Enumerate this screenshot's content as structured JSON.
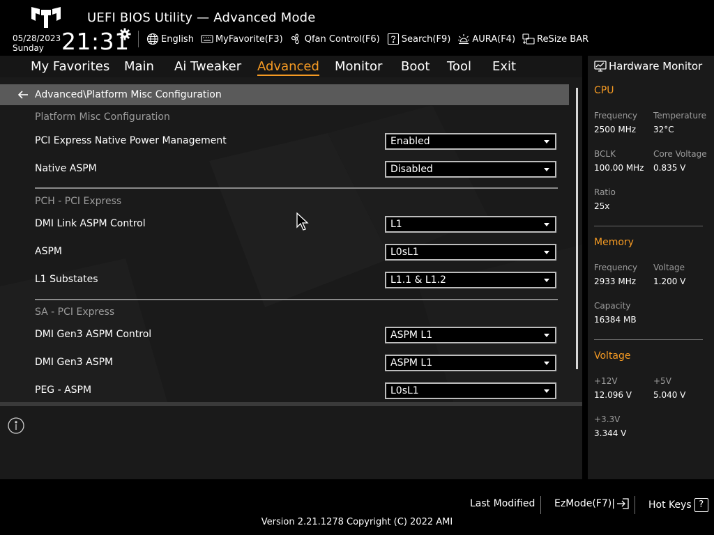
{
  "header": {
    "title": "UEFI BIOS Utility — Advanced Mode",
    "date": "05/28/2023",
    "day": "Sunday",
    "time": "21:31"
  },
  "toolbar": [
    {
      "icon": "globe-icon",
      "label": "English"
    },
    {
      "icon": "keyboard-icon",
      "label": "MyFavorite(F3)"
    },
    {
      "icon": "fan-icon",
      "label": "Qfan Control(F6)"
    },
    {
      "icon": "question-icon",
      "label": "Search(F9)"
    },
    {
      "icon": "aura-icon",
      "label": "AURA(F4)"
    },
    {
      "icon": "resize-bar-icon",
      "label": "ReSize BAR"
    }
  ],
  "menu": {
    "tabs": [
      "My Favorites",
      "Main",
      "Ai Tweaker",
      "Advanced",
      "Monitor",
      "Boot",
      "Tool",
      "Exit"
    ],
    "active": "Advanced"
  },
  "breadcrumb": "Advanced\\Platform Misc Configuration",
  "sections": {
    "platform": "Platform Misc Configuration",
    "pch": "PCH - PCI Express",
    "sa": "SA - PCI Express"
  },
  "settings": [
    {
      "label": "PCI Express Native Power Management",
      "value": "Enabled"
    },
    {
      "label": "Native ASPM",
      "value": "Disabled"
    },
    {
      "label": "DMI Link ASPM Control",
      "value": "L1"
    },
    {
      "label": "ASPM",
      "value": "L0sL1"
    },
    {
      "label": "L1 Substates",
      "value": "L1.1 & L1.2"
    },
    {
      "label": "DMI Gen3 ASPM Control",
      "value": "ASPM L1"
    },
    {
      "label": "DMI Gen3 ASPM",
      "value": "ASPM L1"
    },
    {
      "label": "PEG - ASPM",
      "value": "L0sL1"
    }
  ],
  "hardware_monitor": {
    "title": "Hardware Monitor",
    "cpu": {
      "heading": "CPU",
      "frequency_label": "Frequency",
      "frequency": "2500 MHz",
      "temperature_label": "Temperature",
      "temperature": "32°C",
      "bclk_label": "BCLK",
      "bclk": "100.00 MHz",
      "core_voltage_label": "Core Voltage",
      "core_voltage": "0.835 V",
      "ratio_label": "Ratio",
      "ratio": "25x"
    },
    "memory": {
      "heading": "Memory",
      "frequency_label": "Frequency",
      "frequency": "2933 MHz",
      "voltage_label": "Voltage",
      "voltage": "1.200 V",
      "capacity_label": "Capacity",
      "capacity": "16384 MB"
    },
    "voltage": {
      "heading": "Voltage",
      "v12_label": "+12V",
      "v12": "12.096 V",
      "v5_label": "+5V",
      "v5": "5.040 V",
      "v33_label": "+3.3V",
      "v33": "3.344 V"
    }
  },
  "footer": {
    "last_modified": "Last Modified",
    "ezmode": "EzMode(F7)|",
    "hotkeys": "Hot Keys",
    "hotkeys_key": "?",
    "version": "Version 2.21.1278 Copyright (C) 2022 AMI"
  },
  "colors": {
    "accent": "#f59a23",
    "panel": "#1a1a1a",
    "background": "#000000"
  }
}
